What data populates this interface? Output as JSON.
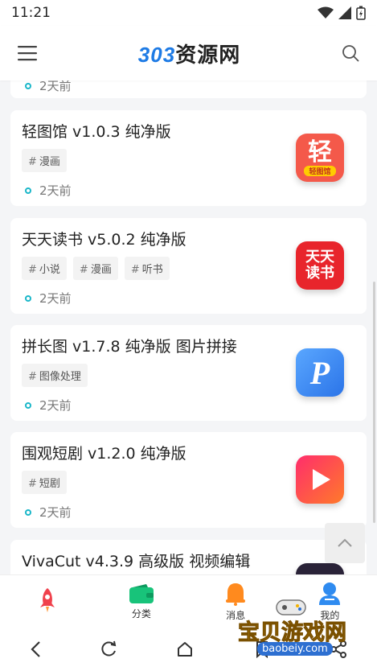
{
  "status_bar": {
    "time": "11:21"
  },
  "header": {
    "logo_num": "303",
    "logo_cn": "资源网"
  },
  "partial_item": {
    "time": "2天前"
  },
  "items": [
    {
      "title": "轻图馆 v1.0.3 纯净版",
      "tags": [
        "漫画"
      ],
      "time": "2天前",
      "icon_text": "轻",
      "icon_sub": "轻图馆",
      "icon_color": "#f4594a"
    },
    {
      "title": "天天读书 v5.0.2 纯净版",
      "tags": [
        "小说",
        "漫画",
        "听书"
      ],
      "time": "2天前",
      "icon_text": "天天\n读书",
      "icon_color": "#e8252c"
    },
    {
      "title": "拼长图 v1.7.8 纯净版 图片拼接",
      "tags": [
        "图像处理"
      ],
      "time": "2天前",
      "icon_text": "P",
      "icon_color": "#3b8ef5"
    },
    {
      "title": "围观短剧 v1.2.0 纯净版",
      "tags": [
        "短剧"
      ],
      "time": "2天前",
      "icon_text": "▶",
      "icon_color": "#f83b6a"
    },
    {
      "title": "VivaCut v4.3.9 高级版 视频编辑",
      "tags": [],
      "time": "",
      "icon_text": "",
      "icon_color": "#2a2338"
    }
  ],
  "tabbar": {
    "tabs": [
      {
        "label": "",
        "icon": "rocket-icon"
      },
      {
        "label": "分类",
        "icon": "wallet-icon"
      },
      {
        "label": "消息",
        "icon": "bell-icon"
      },
      {
        "label": "我的",
        "icon": "user-icon"
      }
    ]
  },
  "watermark": {
    "text": "宝贝游戏网",
    "url": "baobeiy.com"
  },
  "colors": {
    "accent": "#1e7be5",
    "dot": "#1bb7c9",
    "tag_bg": "#f3f3f3"
  }
}
